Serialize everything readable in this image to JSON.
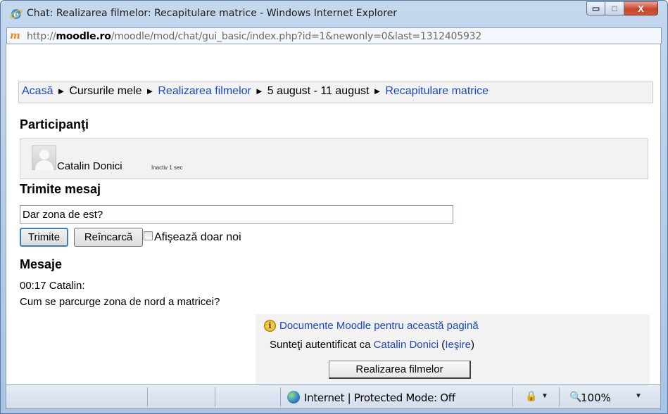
{
  "window": {
    "title": "Chat: Realizarea filmelor: Recapitulare matrice - Windows Internet Explorer",
    "minimize_glyph": "▭",
    "maximize_glyph": "□",
    "close_glyph": "X"
  },
  "address": {
    "icon_text": "m",
    "url_prefix": "http://",
    "url_host": "moodle.ro",
    "url_path": "/moodle/mod/chat/gui_basic/index.php?id=1&newonly=0&last=1312405932"
  },
  "breadcrumb": {
    "items": [
      "Acasă",
      "Cursurile mele",
      "Realizarea filmelor",
      "5 august - 11 august",
      "Recapitulare matrice"
    ],
    "separator": "►"
  },
  "participants": {
    "heading": "Participanţi",
    "users": [
      {
        "name": "Catalin Donici",
        "status": "Inactiv 1 sec"
      }
    ]
  },
  "send": {
    "heading": "Trimite mesaj",
    "input_value": "Dar zona de est?",
    "send_label": "Trimite",
    "reload_label": "Reîncarcă",
    "only_new_label": "Afişează doar noi"
  },
  "messages": {
    "heading": "Mesaje",
    "items": [
      {
        "header": "00:17 Catalin:",
        "text": "Cum se parcurge zona de nord a matricei?"
      }
    ]
  },
  "footer": {
    "info_glyph": "i",
    "docs_link": "Documente Moodle pentru această pagină",
    "auth_prefix": "Sunteţi autentificat ca ",
    "auth_user": "Catalin Donici",
    "logout_open": " (",
    "logout_label": "Ieşire",
    "logout_close": ")",
    "course_button": "Realizarea filmelor"
  },
  "statusbar": {
    "zone": "Internet | Protected Mode: Off",
    "zoom": "100%",
    "lock_glyph": "🔒",
    "zoom_glyph": "🔍",
    "dropdown_glyph": "▼"
  }
}
